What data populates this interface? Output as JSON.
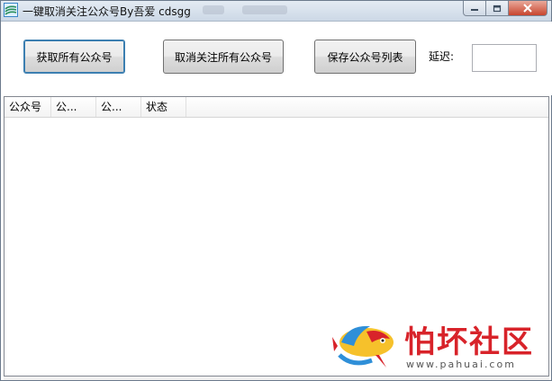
{
  "window": {
    "title": "一键取消关注公众号By吾爱 cdsgg"
  },
  "toolbar": {
    "fetch_label": "获取所有公众号",
    "unfollow_label": "取消关注所有公众号",
    "save_label": "保存公众号列表",
    "delay_label": "延迟:",
    "delay_value": ""
  },
  "list": {
    "columns": [
      "公众号",
      "公...",
      "公...",
      "状态"
    ],
    "rows": []
  },
  "watermark": {
    "text": "怕坏社区",
    "url": "www.pahuai.com"
  },
  "colors": {
    "accent": "#d8232a",
    "close": "#c8452e"
  }
}
